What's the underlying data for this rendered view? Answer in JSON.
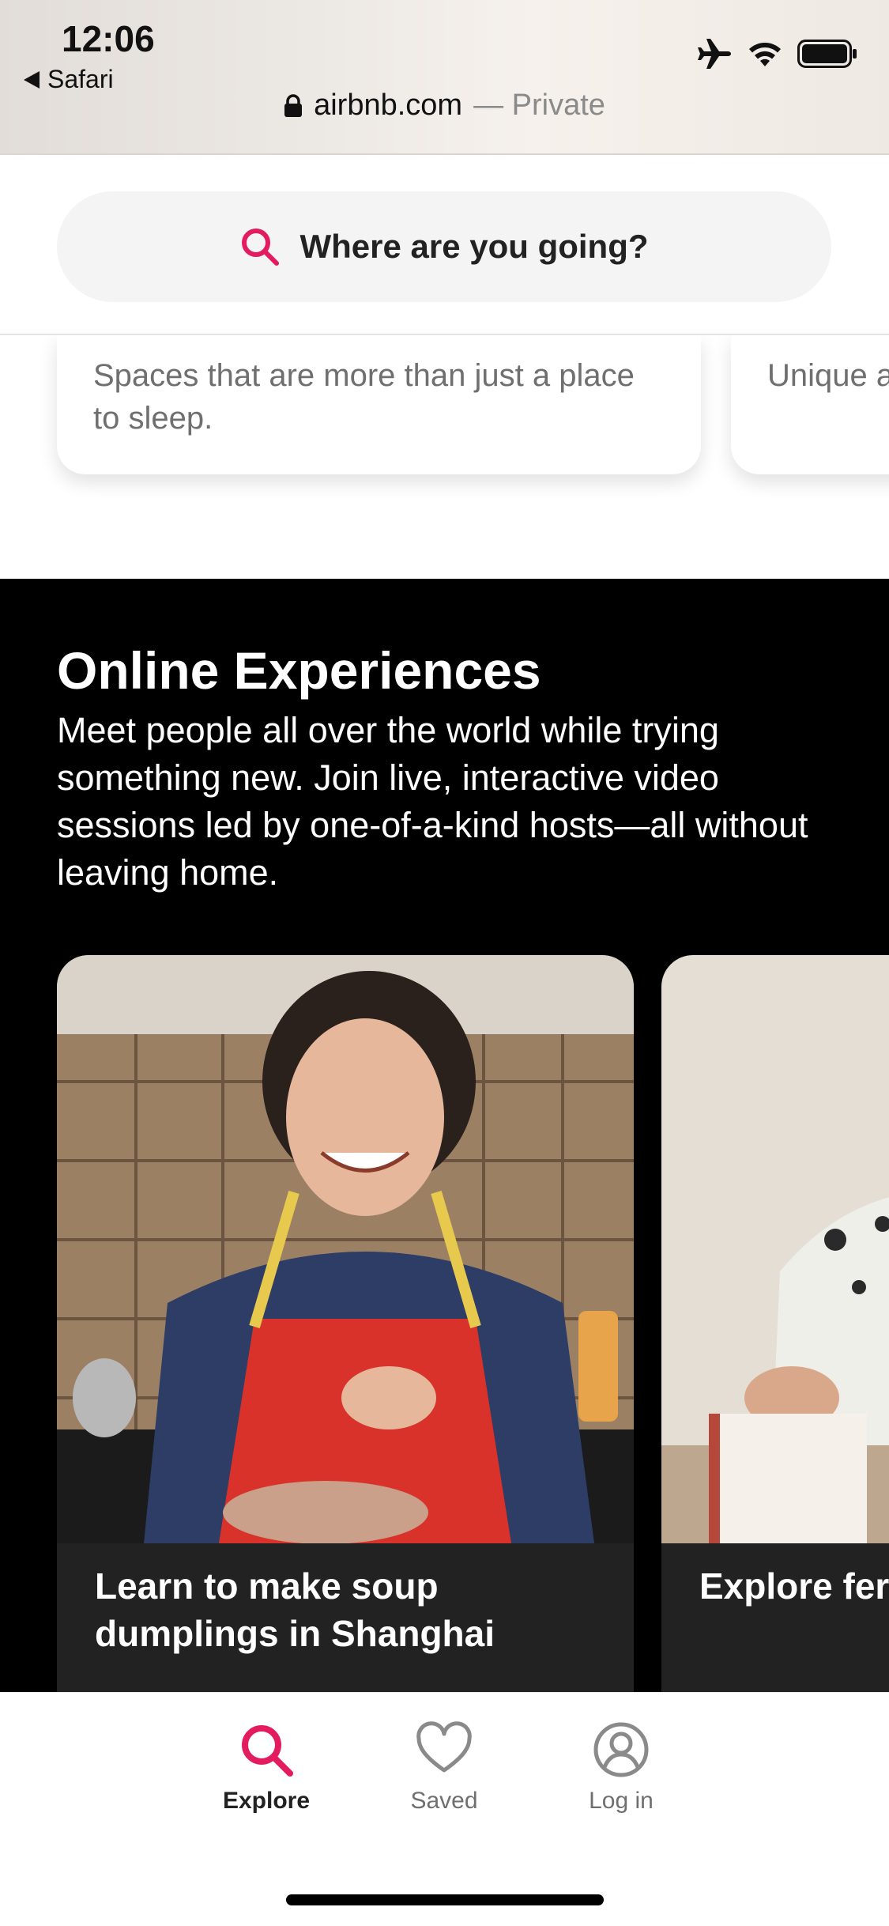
{
  "status_bar": {
    "time": "12:06",
    "back_label": "Safari",
    "icons": [
      "airplane-icon",
      "wifi-icon",
      "battery-icon"
    ],
    "url_domain": "airbnb.com",
    "url_mode": "— Private"
  },
  "search": {
    "placeholder": "Where are you going?",
    "accent_color": "#E31C5F"
  },
  "cards": [
    {
      "text": "Spaces that are more than just a place to sleep."
    },
    {
      "text": "Unique a led by a"
    }
  ],
  "online_experiences": {
    "title": "Online Experiences",
    "description": "Meet people all over the world while trying something new. Join live, interactive video sessions led by one-of-a-kind hosts—all without leaving home.",
    "experiences": [
      {
        "title": "Learn to make soup dumplings in Shanghai"
      },
      {
        "title": "Explore fer street art a"
      }
    ]
  },
  "bottom_nav": {
    "items": [
      {
        "label": "Explore",
        "icon": "search-icon",
        "active": true
      },
      {
        "label": "Saved",
        "icon": "heart-icon",
        "active": false
      },
      {
        "label": "Log in",
        "icon": "profile-icon",
        "active": false
      }
    ]
  }
}
